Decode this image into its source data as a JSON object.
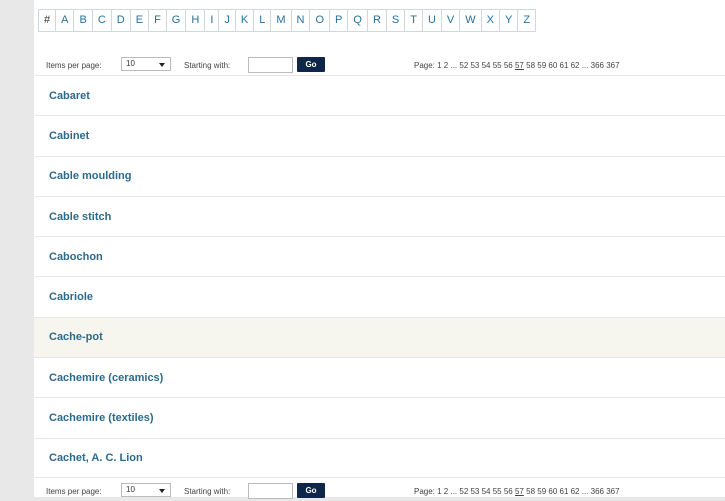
{
  "alphabet": [
    "#",
    "A",
    "B",
    "C",
    "D",
    "E",
    "F",
    "G",
    "H",
    "I",
    "J",
    "K",
    "L",
    "M",
    "N",
    "O",
    "P",
    "Q",
    "R",
    "S",
    "T",
    "U",
    "V",
    "W",
    "X",
    "Y",
    "Z"
  ],
  "pager_top": {
    "items_per_page_label": "Items per page:",
    "items_per_page_value": "10",
    "starting_with_label": "Starting with:",
    "starting_with_value": "",
    "go_label": "Go",
    "pages_prefix": "Page: 1 2 ... 52 53 54 55 56",
    "current_page": "57",
    "pages_suffix": "58 59 60 61 62 ... 366 367"
  },
  "pager_bottom": {
    "items_per_page_label": "Items per page:",
    "items_per_page_value": "10",
    "starting_with_label": "Starting with:",
    "starting_with_value": "",
    "go_label": "Go",
    "pages_prefix": "Page: 1 2 ... 52 53 54 55 56",
    "current_page": "57",
    "pages_suffix": "58 59 60 61 62 ... 366 367"
  },
  "entries": [
    "Cabaret",
    "Cabinet",
    "Cable moulding",
    "Cable stitch",
    "Cabochon",
    "Cabriole",
    "Cache-pot",
    "Cachemire (ceramics)",
    "Cachemire (textiles)",
    "Cachet, A. C. Lion"
  ],
  "highlighted_entry": "Cache-pot"
}
